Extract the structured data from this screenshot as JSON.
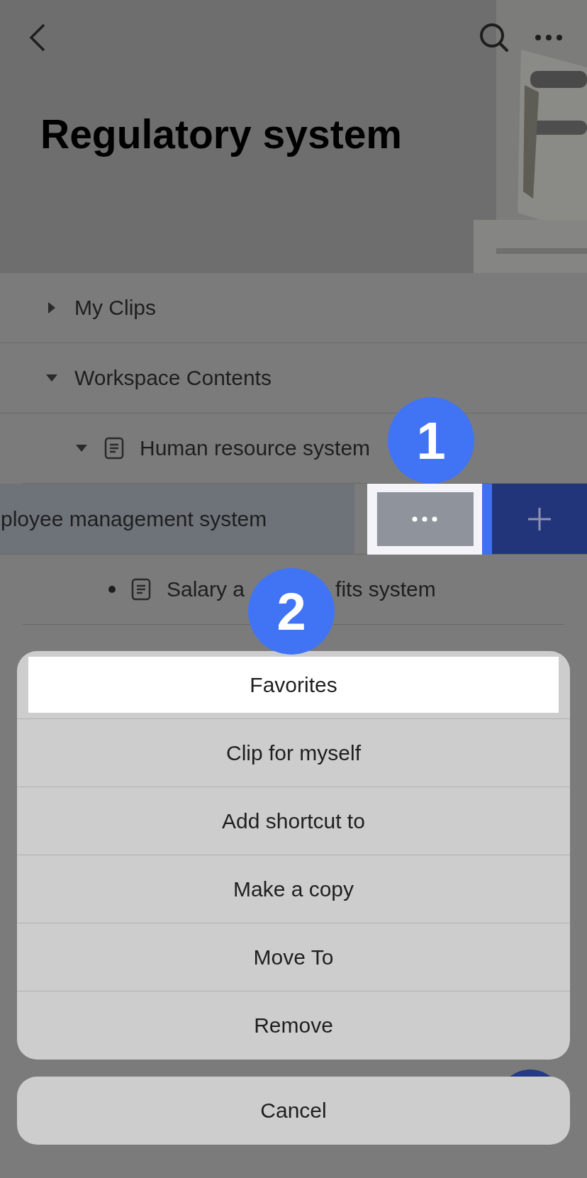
{
  "header": {
    "title": "Regulatory system"
  },
  "tree": [
    {
      "kind": "folder",
      "label": "My Clips",
      "expanded": false
    },
    {
      "kind": "folder",
      "label": "Workspace Contents",
      "expanded": true,
      "children": [
        {
          "kind": "doc",
          "label": "Human resource system",
          "expanded": true,
          "children": [
            {
              "kind": "swiped",
              "label": "ployee management system",
              "more_highlighted": true
            },
            {
              "kind": "leaf",
              "label_parts": [
                "Salary a",
                "fits system"
              ]
            }
          ]
        }
      ]
    }
  ],
  "callouts": [
    {
      "number": "1"
    },
    {
      "number": "2"
    }
  ],
  "action_sheet": {
    "items": [
      {
        "label": "Favorites",
        "highlighted": true
      },
      {
        "label": "Clip for myself",
        "highlighted": false
      },
      {
        "label": "Add shortcut to",
        "highlighted": false
      },
      {
        "label": "Make a copy",
        "highlighted": false
      },
      {
        "label": "Move To",
        "highlighted": false
      },
      {
        "label": "Remove",
        "highlighted": false
      }
    ],
    "cancel": "Cancel"
  }
}
